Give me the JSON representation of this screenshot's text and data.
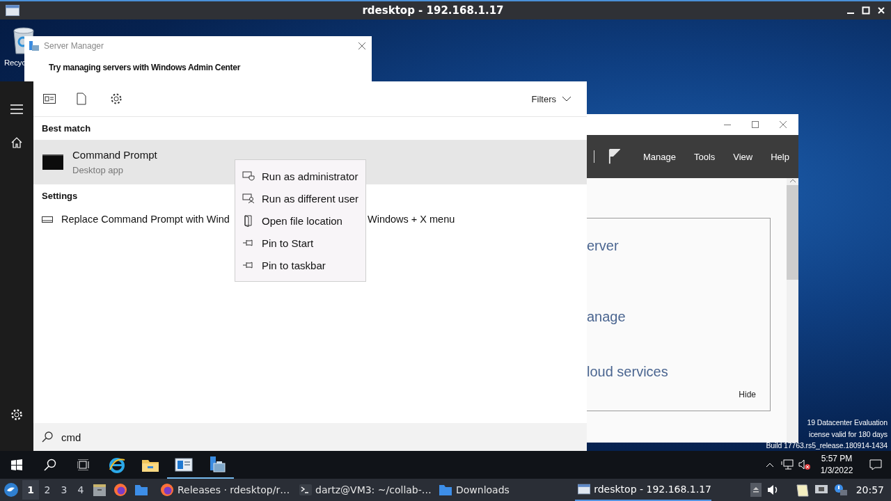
{
  "outer_window": {
    "title": "rdesktop - 192.168.1.17"
  },
  "desktop_icons": [
    {
      "label": "Recyc"
    }
  ],
  "notification": {
    "title": "Server Manager",
    "message": "Try managing servers with Windows Admin Center"
  },
  "server_manager": {
    "menu": [
      "Manage",
      "Tools",
      "View",
      "Help"
    ],
    "card_lines": [
      "erver",
      "anage",
      "loud services"
    ],
    "hide": "Hide"
  },
  "start_menu": {
    "filters": "Filters",
    "sections": [
      {
        "heading": "Best match",
        "items": [
          {
            "kind": "app",
            "title": "Command Prompt",
            "subtitle": "Desktop app",
            "selected": true
          }
        ]
      },
      {
        "heading": "Settings",
        "items": [
          {
            "kind": "setting",
            "text_parts": [
              "Replace Command Prompt with Wind",
              "Windows + X menu"
            ],
            "selected": false
          }
        ]
      }
    ],
    "search": {
      "value": "cmd"
    }
  },
  "context_menu": {
    "items": [
      {
        "kind": "admin",
        "label": "Run as administrator"
      },
      {
        "kind": "user",
        "label": "Run as different user"
      },
      {
        "kind": "folder",
        "label": "Open file location"
      },
      {
        "kind": "pin",
        "label": "Pin to Start"
      },
      {
        "kind": "pin",
        "label": "Pin to taskbar"
      }
    ]
  },
  "evaluation_notice": [
    "19 Datacenter Evaluation",
    "icense valid for 180 days",
    "Build 17763.rs5_release.180914-1434"
  ],
  "windows_taskbar": {
    "apps": [
      {
        "kind": "ie",
        "open": false
      },
      {
        "kind": "explorer",
        "open": false
      },
      {
        "kind": "window",
        "open": true
      },
      {
        "kind": "server-manager",
        "open": true
      }
    ],
    "time": "5:57 PM",
    "date": "1/3/2022"
  },
  "panel": {
    "workspaces": [
      {
        "label": "1",
        "selected": true
      },
      {
        "label": "2",
        "selected": false
      },
      {
        "label": "3",
        "selected": false
      },
      {
        "label": "4",
        "selected": false
      }
    ],
    "tasks": [
      {
        "kind": "firefox",
        "label": "Releases · rdesktop/r…",
        "selected": false
      },
      {
        "kind": "terminal",
        "label": "dartz@VM3: ~/collab-…",
        "selected": false
      },
      {
        "kind": "folder",
        "label": "Downloads",
        "selected": false
      },
      {
        "kind": "window",
        "label": "rdesktop - 192.168.1.17",
        "selected": true
      }
    ],
    "clock": "20:57"
  }
}
